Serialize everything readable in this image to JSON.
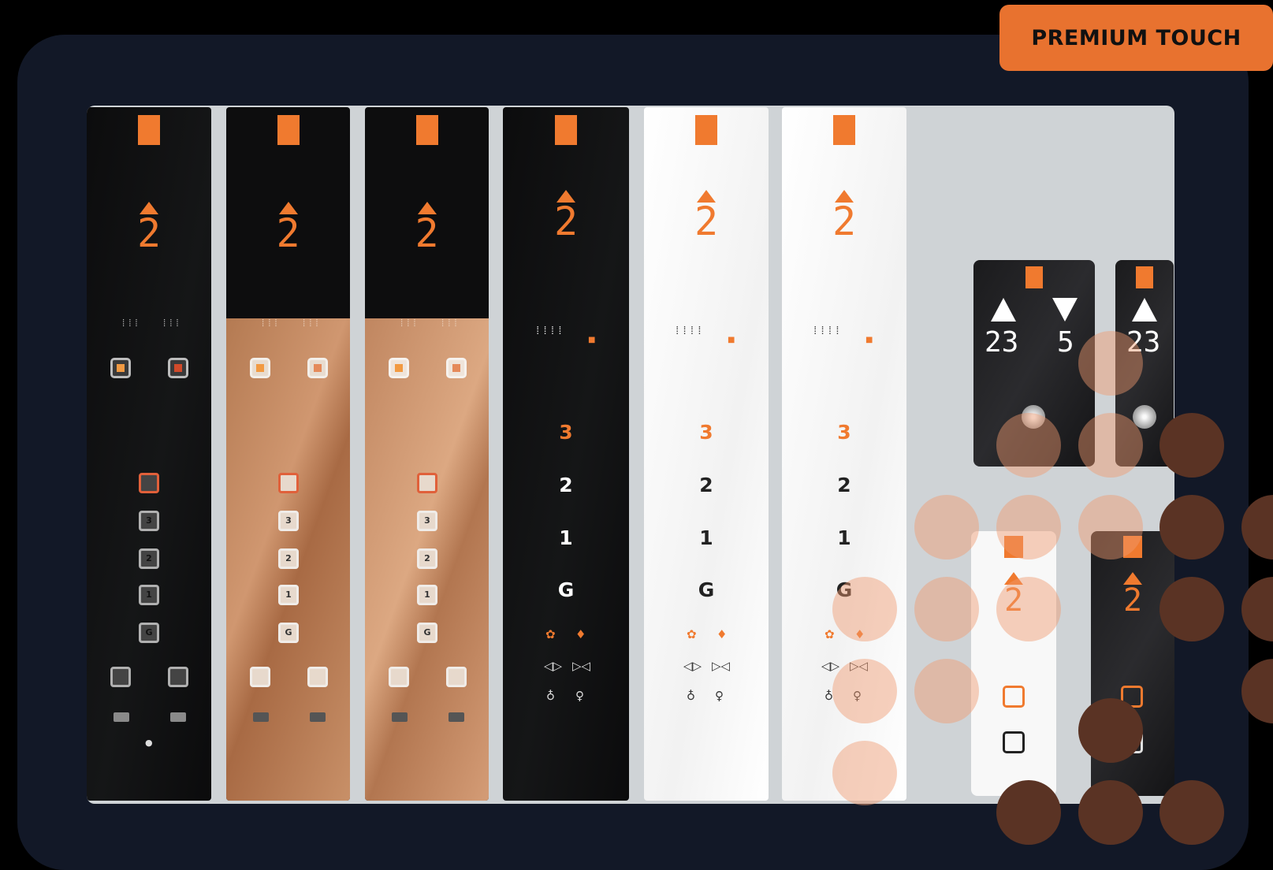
{
  "badge": {
    "label": "PREMIUM TOUCH"
  },
  "panels": [
    {
      "style": "black",
      "indicator_digit": "2",
      "floors": [
        "3",
        "2",
        "1",
        "G"
      ]
    },
    {
      "style": "copper",
      "indicator_digit": "2",
      "floors": [
        "3",
        "2",
        "1",
        "G"
      ]
    },
    {
      "style": "copper",
      "indicator_digit": "2",
      "floors": [
        "3",
        "2",
        "1",
        "G"
      ]
    },
    {
      "style": "black",
      "indicator_digit": "2",
      "floors": [
        "3",
        "2",
        "1",
        "G"
      ]
    },
    {
      "style": "white",
      "indicator_digit": "2",
      "floors": [
        "3",
        "2",
        "1",
        "G"
      ]
    },
    {
      "style": "white",
      "indicator_digit": "2",
      "floors": [
        "3",
        "2",
        "1",
        "G"
      ]
    }
  ],
  "hall_cards": {
    "left_up_floor": "23",
    "left_down_floor": "5",
    "right_floor": "23",
    "white_indicator_digit": "2",
    "black_indicator_digit": "2"
  },
  "colors": {
    "accent": "#f07a2f",
    "frame": "#121827",
    "badge": "#e8722f"
  }
}
